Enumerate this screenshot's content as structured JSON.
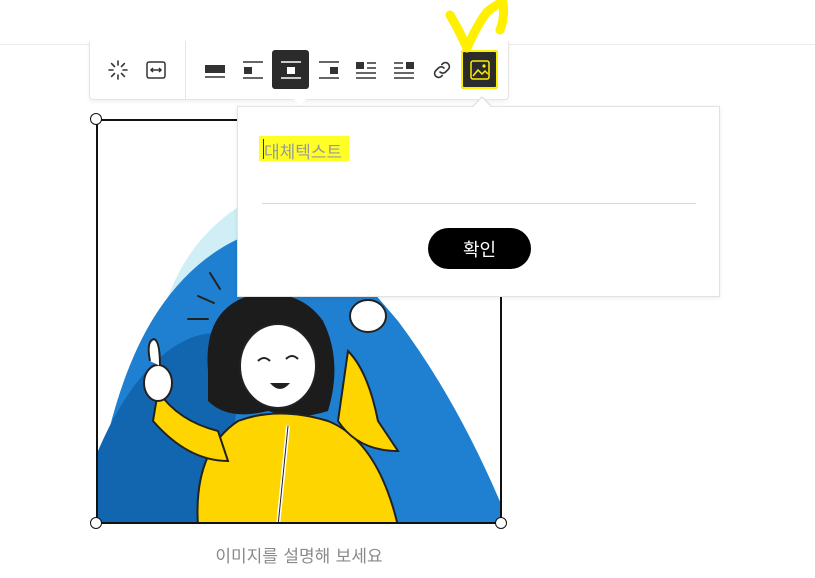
{
  "toolbar": {
    "buttons": [
      {
        "icon": "loading-sparkle-icon"
      },
      {
        "icon": "fit-width-icon"
      },
      {
        "icon": "align-full-icon"
      },
      {
        "icon": "align-left-icon"
      },
      {
        "icon": "align-center-icon",
        "active": true
      },
      {
        "icon": "align-right-icon"
      },
      {
        "icon": "wrap-left-icon"
      },
      {
        "icon": "wrap-right-icon"
      },
      {
        "icon": "link-icon"
      },
      {
        "icon": "alt-text-image-icon",
        "active": true
      }
    ]
  },
  "alt_text": {
    "placeholder": "대체텍스트",
    "value": "",
    "confirm_label": "확인"
  },
  "image": {
    "caption_placeholder": "이미지를 설명해 보세요"
  },
  "colors": {
    "active_button": "#2b2b2b",
    "highlight": "#ffff26",
    "confirm_button": "#000000",
    "illustration_blue": "#1f7fd0",
    "illustration_yellow": "#ffd500"
  }
}
